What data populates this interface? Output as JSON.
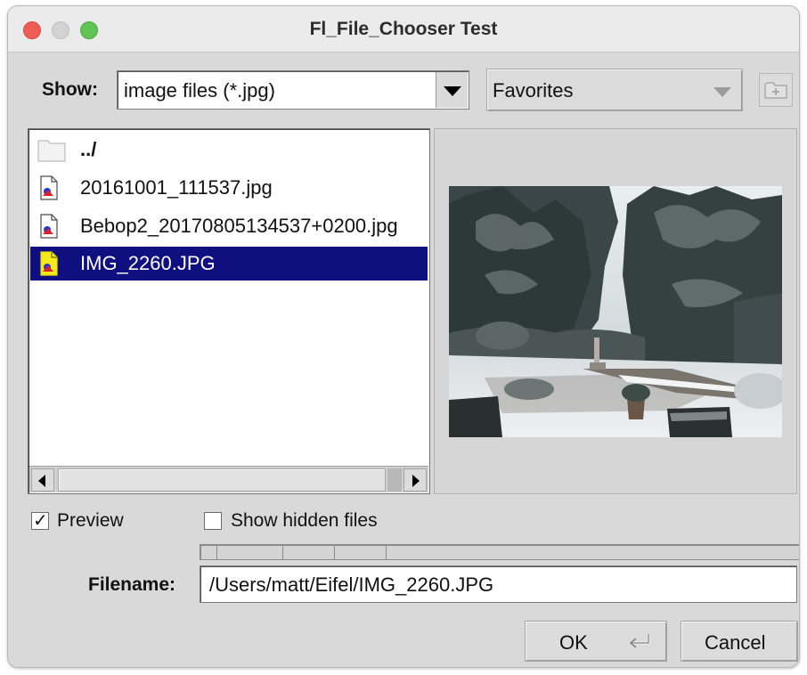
{
  "window": {
    "title": "Fl_File_Chooser Test"
  },
  "toolbar": {
    "show_label": "Show:",
    "filter_value": "image files (*.jpg)",
    "favorites_label": "Favorites",
    "new_folder_icon": "new-folder-icon"
  },
  "file_list": {
    "items": [
      {
        "name": "../",
        "icon": "folder-icon",
        "selected": false
      },
      {
        "name": "20161001_111537.jpg",
        "icon": "image-file-icon",
        "selected": false
      },
      {
        "name": "Bebop2_20170805134537+0200.jpg",
        "icon": "image-file-icon",
        "selected": false
      },
      {
        "name": "IMG_2260.JPG",
        "icon": "image-file-icon",
        "selected": true
      }
    ],
    "selection_color": "#0f0f7f"
  },
  "preview": {
    "image_alt": "snowy garden"
  },
  "options": {
    "preview_label": "Preview",
    "preview_checked": true,
    "hidden_label": "Show hidden files",
    "hidden_checked": false
  },
  "filename": {
    "label": "Filename:",
    "value": "/Users/matt/Eifel/IMG_2260.JPG"
  },
  "buttons": {
    "ok_label": "OK",
    "cancel_label": "Cancel"
  },
  "colors": {
    "window_bg": "#d9d9d9",
    "titlebar_bg": "#ebebeb",
    "close": "#ee5c55",
    "minimize": "#d2d2d2",
    "maximize": "#5fc453"
  }
}
